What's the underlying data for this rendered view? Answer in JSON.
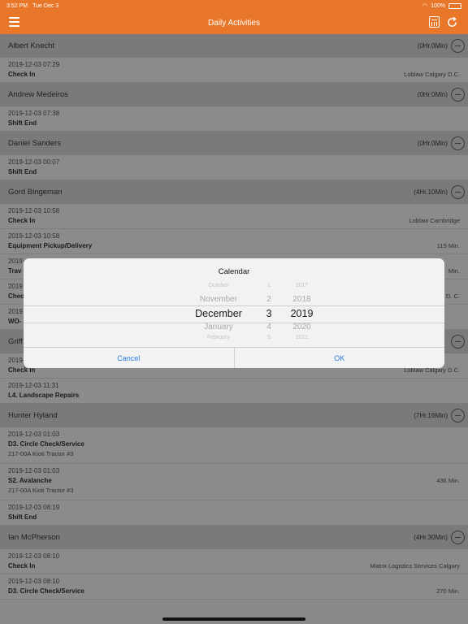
{
  "status": {
    "time": "3:52 PM",
    "date": "Tue Dec 3",
    "battery": "100%"
  },
  "nav": {
    "title": "Daily Activities"
  },
  "groups": [
    {
      "name": "Albert  Knecht",
      "duration": "(0Hr.0Min)",
      "items": [
        {
          "time": "2019-12-03 07:29",
          "activity": "Check In",
          "right": "Loblaw Calgary D.C."
        }
      ]
    },
    {
      "name": "Andrew Medeiros",
      "duration": "(0Hr.0Min)",
      "items": [
        {
          "time": "2019-12-03 07:38",
          "activity": "Shift End",
          "right": ""
        }
      ]
    },
    {
      "name": "Daniel  Sanders",
      "duration": "(0Hr.0Min)",
      "items": [
        {
          "time": "2019-12-03 00:07",
          "activity": "Shift End",
          "right": ""
        }
      ]
    },
    {
      "name": "Gord Bingeman",
      "duration": "(4Hr.10Min)",
      "items": [
        {
          "time": "2019-12-03 10:58",
          "activity": "Check In",
          "right": "Loblaw Cambridge"
        },
        {
          "time": "2019-12-03 10:58",
          "activity": "Equipment Pickup/Delivery",
          "right": "119 Min."
        },
        {
          "time": "2019",
          "activity": "Trav",
          "right": "Min."
        },
        {
          "time": "2019",
          "activity": "Chec",
          "right": "D. C."
        },
        {
          "time": "2019",
          "activity": "WO-",
          "right": ""
        }
      ]
    },
    {
      "name": "Griff",
      "duration": "",
      "items": [
        {
          "time": "2019-12-03 11:30",
          "activity": "Check In",
          "right": "Loblaw Calgary D.C."
        },
        {
          "time": "2019-12-03 11:31",
          "activity": "L4. Landscape Repairs",
          "right": ""
        }
      ]
    },
    {
      "name": "Hunter  Hyland",
      "duration": "(7Hr.16Min)",
      "items": [
        {
          "time": "2019-12-03 01:03",
          "activity": "D3. Circle Check/Service",
          "sub": "217-00A Kioti Tractor #3",
          "right": ""
        },
        {
          "time": "2019-12-03 01:03",
          "activity": "S2. Avalanche",
          "sub": "217-00A Kioti Tractor #3",
          "right": "436 Min."
        },
        {
          "time": "2019-12-03 08:19",
          "activity": "Shift End",
          "right": ""
        }
      ]
    },
    {
      "name": "Ian McPherson",
      "duration": "(4Hr.30Min)",
      "items": [
        {
          "time": "2019-12-03 08:10",
          "activity": "Check In",
          "right": "Matrix Logistics Services Calgary"
        },
        {
          "time": "2019-12-03 08:10",
          "activity": "D3. Circle Check/Service",
          "right": "270 Min."
        }
      ]
    }
  ],
  "dialog": {
    "title": "Calendar",
    "picker": {
      "months": [
        "October",
        "November",
        "December",
        "January",
        "February"
      ],
      "days": [
        "1",
        "2",
        "3",
        "4",
        "5"
      ],
      "years": [
        "2017",
        "2018",
        "2019",
        "2020",
        "2021"
      ]
    },
    "cancel": "Cancel",
    "ok": "OK"
  }
}
